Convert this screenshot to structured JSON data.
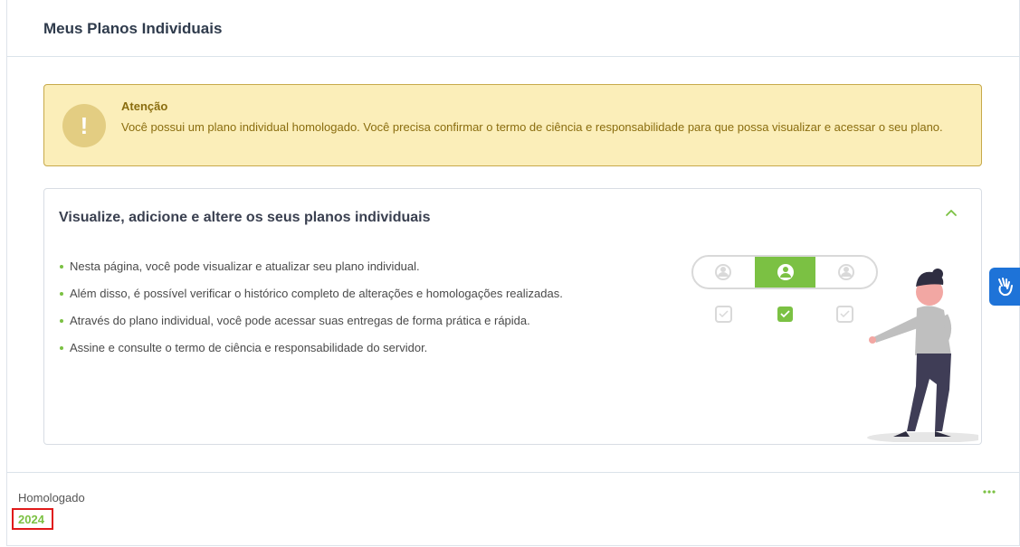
{
  "page": {
    "title": "Meus Planos Individuais"
  },
  "alert": {
    "title": "Atenção",
    "message": "Você possui um plano individual homologado. Você precisa confirmar o termo de ciência e responsabilidade para que possa visualizar e acessar o seu plano.",
    "icon": "exclamation-icon",
    "colors": {
      "background": "#fbeeb9",
      "border": "#c7a94a",
      "text": "#8a6d0f"
    }
  },
  "info_card": {
    "title": "Visualize, adicione e altere os seus planos individuais",
    "bullets": [
      "Nesta página, você pode visualizar e atualizar seu plano individual.",
      "Além disso, é possível verificar o histórico completo de alterações e homologações realizadas.",
      "Através do plano individual, você pode acessar suas entregas de forma prática e rápida.",
      "Assine e consulte o termo de ciência e responsabilidade do servidor."
    ],
    "collapse_icon": "chevron-up-icon",
    "accent": "#7bc143"
  },
  "plan_item": {
    "status": "Homologado",
    "year": "2024",
    "menu_icon": "more-dots-icon"
  },
  "accessibility": {
    "icon": "sign-language-icon",
    "color": "#1e73d8"
  }
}
